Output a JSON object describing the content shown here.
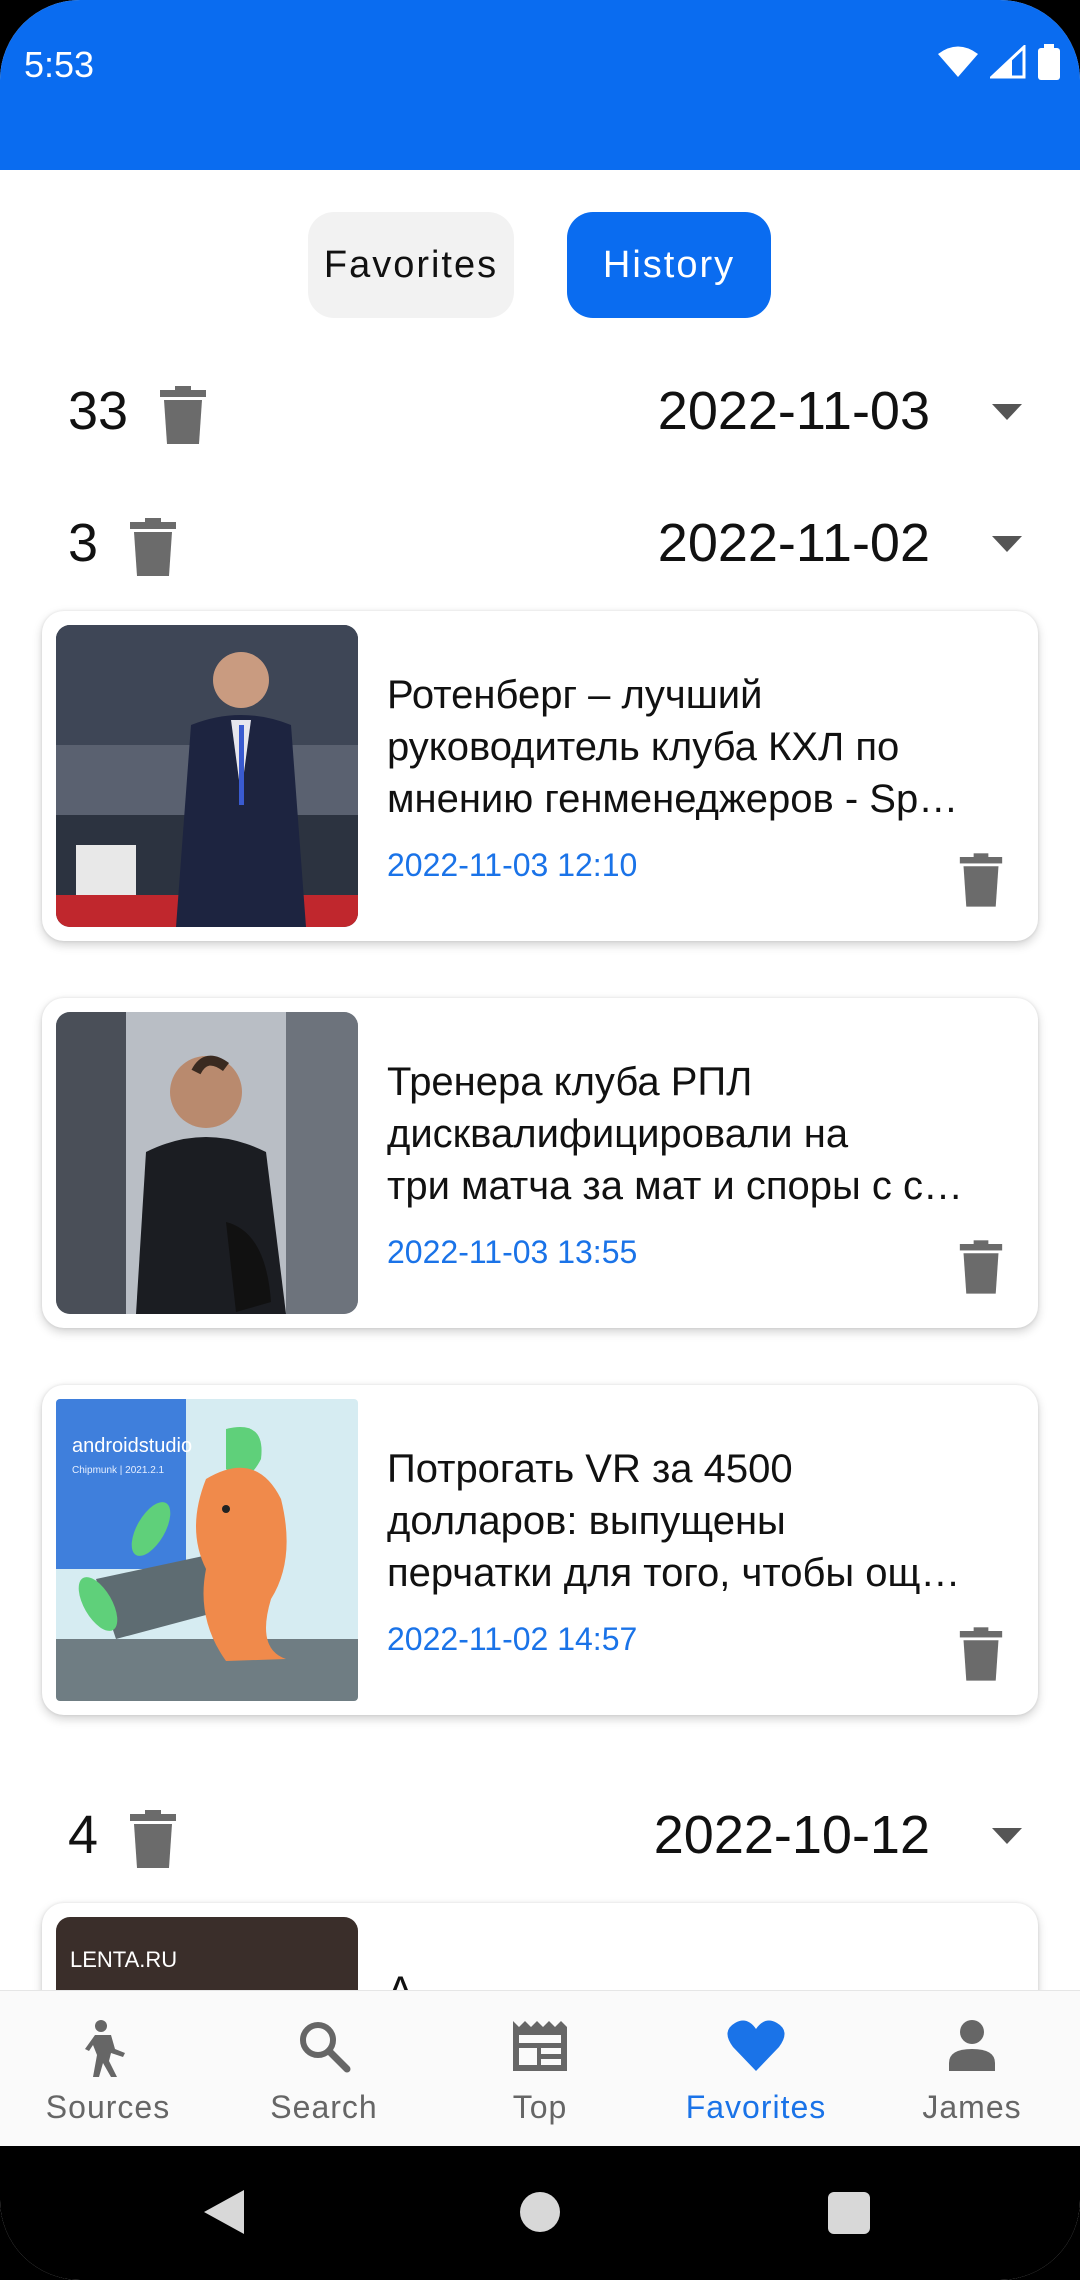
{
  "status_bar": {
    "time": "5:53"
  },
  "tabs": {
    "favorites": "Favorites",
    "history": "History",
    "active": "History"
  },
  "groups": [
    {
      "count": "33",
      "date": "2022-11-03"
    },
    {
      "count": "3",
      "date": "2022-11-02"
    },
    {
      "count": "4",
      "date": "2022-10-12"
    }
  ],
  "articles": [
    {
      "title_lines": [
        "Ротенберг – лучший",
        "руководитель клуба КХЛ по",
        "мнению генменеджеров - Sp…"
      ],
      "datetime": "2022-11-03 12:10",
      "thumb_icon": "photo-man-in-suit-hockey-arena"
    },
    {
      "title_lines": [
        "Тренера клуба РПЛ",
        "дисквалифицировали на",
        "три матча за мат и споры с с…"
      ],
      "datetime": "2022-11-03 13:55",
      "thumb_icon": "photo-coach-in-corridor"
    },
    {
      "title_lines": [
        "Потрогать VR за 4500",
        "долларов: выпущены",
        "перчатки для того, чтобы ощ…"
      ],
      "datetime": "2022-11-02 14:57",
      "thumb_icon": "android-studio-chipmunk-illustration",
      "thumb_text": {
        "brand": "androidstudio",
        "subtitle": "Chipmunk | 2021.2.1"
      }
    }
  ],
  "partial_card": {
    "thumb_text": "LENTA.RU",
    "title_start": "А"
  },
  "bottom_nav": [
    {
      "label": "Sources",
      "icon": "person-walking-icon"
    },
    {
      "label": "Search",
      "icon": "search-icon"
    },
    {
      "label": "Top",
      "icon": "newspaper-icon"
    },
    {
      "label": "Favorites",
      "icon": "heart-icon",
      "active": true
    },
    {
      "label": "James",
      "icon": "person-icon"
    }
  ],
  "colors": {
    "primary": "#0a6cf0",
    "link": "#1a73e8",
    "icon_gray": "#6b6b6b"
  }
}
